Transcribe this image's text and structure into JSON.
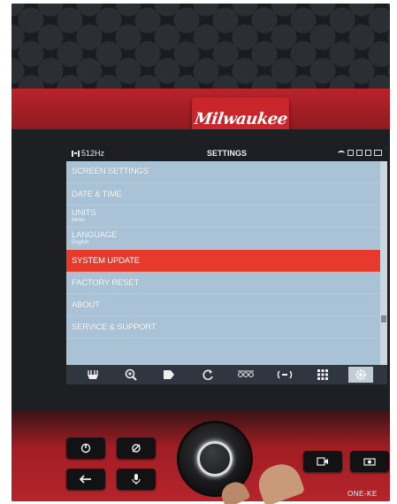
{
  "device": {
    "brand": "Milwaukee",
    "footer_brand": "ONE-KE"
  },
  "status_bar": {
    "frequency": "512Hz",
    "title": "SETTINGS",
    "icons": [
      "wifi-icon",
      "alert-icon",
      "card-icon",
      "monitor-icon",
      "battery-icon"
    ]
  },
  "menu": {
    "items": [
      {
        "label": "SCREEN SETTINGS",
        "sub": ""
      },
      {
        "label": "DATE & TIME",
        "sub": ""
      },
      {
        "label": "UNITS",
        "sub": "Meter"
      },
      {
        "label": "LANGUAGE",
        "sub": "English"
      },
      {
        "label": "SYSTEM UPDATE",
        "sub": "",
        "selected": true
      },
      {
        "label": "FACTORY RESET",
        "sub": ""
      },
      {
        "label": "ABOUT",
        "sub": ""
      },
      {
        "label": "SERVICE & SUPPORT",
        "sub": ""
      }
    ]
  },
  "toolbar": {
    "icons": [
      "lighting-icon",
      "zoom-icon",
      "tag-icon",
      "rotate-icon",
      "distance-icon",
      "sonde-icon",
      "grid-icon",
      "settings-icon"
    ],
    "active": "settings-icon"
  },
  "colors": {
    "screen_bg": "#a9c2d6",
    "selected": "#e83a2c",
    "status_bar": "#1c1e24",
    "toolbar": "#30363f",
    "brand_red": "#c9262c"
  }
}
